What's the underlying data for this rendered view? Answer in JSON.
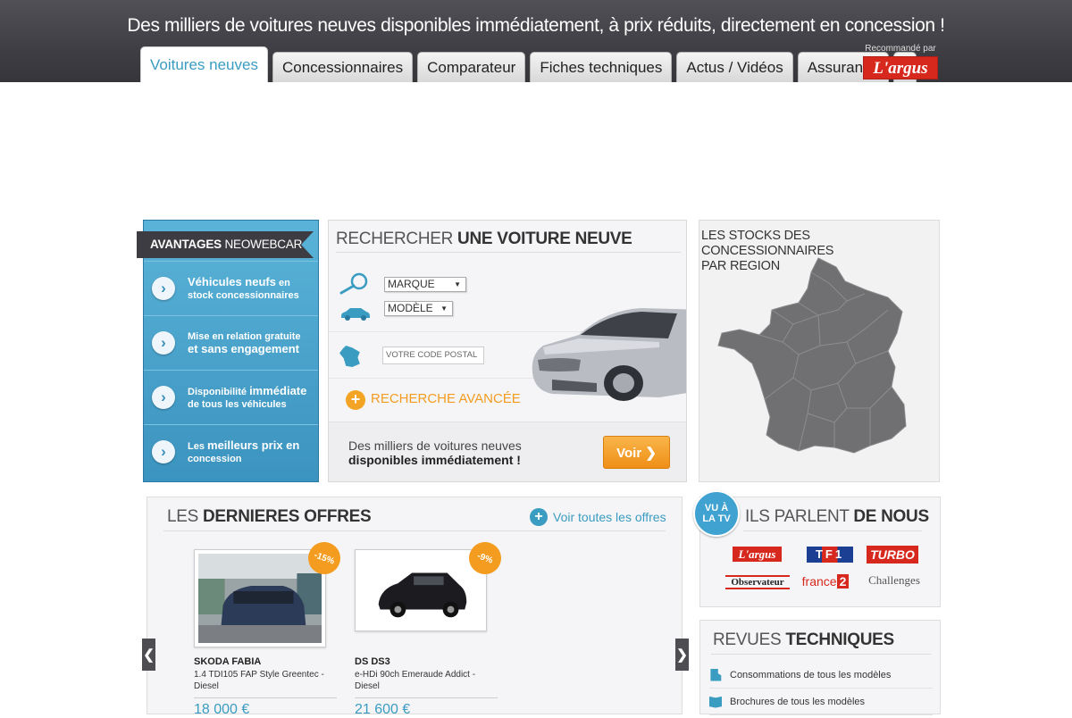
{
  "header": {
    "tagline": "Des milliers de voitures neuves disponibles immédiatement, à prix réduits, directement en concession !",
    "tabs": [
      {
        "label": "Voitures neuves",
        "active": true
      },
      {
        "label": "Concessionnaires",
        "active": false
      },
      {
        "label": "Comparateur",
        "active": false
      },
      {
        "label": "Fiches techniques",
        "active": false
      },
      {
        "label": "Actus / Vidéos",
        "active": false
      },
      {
        "label": "Assurance",
        "active": false
      }
    ],
    "pin_icon": "map-pin-icon",
    "recommande_label": "Recommandé par",
    "recommande_logo": "L'argus"
  },
  "avantages": {
    "title_bold": "AVANTAGES",
    "title_rest": " NEOWEBCAR",
    "items": [
      {
        "l1": "Véhicules neufs",
        "l1_rest": " en",
        "l2": "stock concessionnaires"
      },
      {
        "l1": "Mise en relation gratuite",
        "l1_rest": "",
        "l2": "et sans engagement"
      },
      {
        "l1": "Disponibilité ",
        "l1_rest": "immédiate",
        "l2": "de tous les véhicules"
      },
      {
        "l1": "Les ",
        "l1_rest": "meilleurs prix en",
        "l2": "concession"
      }
    ]
  },
  "search": {
    "title_light": "RECHERCHER ",
    "title_bold": "UNE VOITURE NEUVE",
    "marque": "MARQUE",
    "modele": "MODÈLE",
    "postal_placeholder": "VOTRE CODE POSTAL",
    "advanced": "RECHERCHE AVANCÉE",
    "bottom_line1": "Des milliers de voitures neuves",
    "bottom_line2": "disponibles immédiatement !",
    "voir": "Voir ❯"
  },
  "map": {
    "title_l1": "LES STOCKS DES CONCESSIONNAIRES",
    "title_l2": "PAR REGION"
  },
  "offres": {
    "title_light": "LES ",
    "title_bold": "DERNIERES OFFRES",
    "voir_toutes": "Voir toutes les offres",
    "cards": [
      {
        "badge": "-15%",
        "name": "SKODA FABIA",
        "desc": "1.4 TDI105 FAP Style Greentec - Diesel",
        "price": "18 000 €"
      },
      {
        "badge": "-9%",
        "name": "DS DS3",
        "desc": "e-HDi 90ch Emeraude Addict - Diesel",
        "price": "21 600 €"
      }
    ],
    "prev": "❮",
    "next": "❯"
  },
  "parlent": {
    "badge_l1": "VU À",
    "badge_l2": "LA TV",
    "title_light": "ILS PARLENT ",
    "title_bold": "DE NOUS",
    "media": {
      "largus": "L'argus",
      "tf1": "TF1",
      "turbo": "TURBO",
      "obs": "Observateur",
      "fr2_text": "france",
      "fr2_num": "2",
      "challenges": "Challenges"
    }
  },
  "revues": {
    "title_light": "REVUES ",
    "title_bold": "TECHNIQUES",
    "items": [
      {
        "label": "Consommations de tous les modèles",
        "icon": "fuel-icon"
      },
      {
        "label": "Brochures de tous les modèles",
        "icon": "book-icon"
      }
    ]
  },
  "colors": {
    "accent_blue": "#3a9cc0",
    "accent_orange": "#f39c1f",
    "header_dark": "#3e3e44"
  }
}
